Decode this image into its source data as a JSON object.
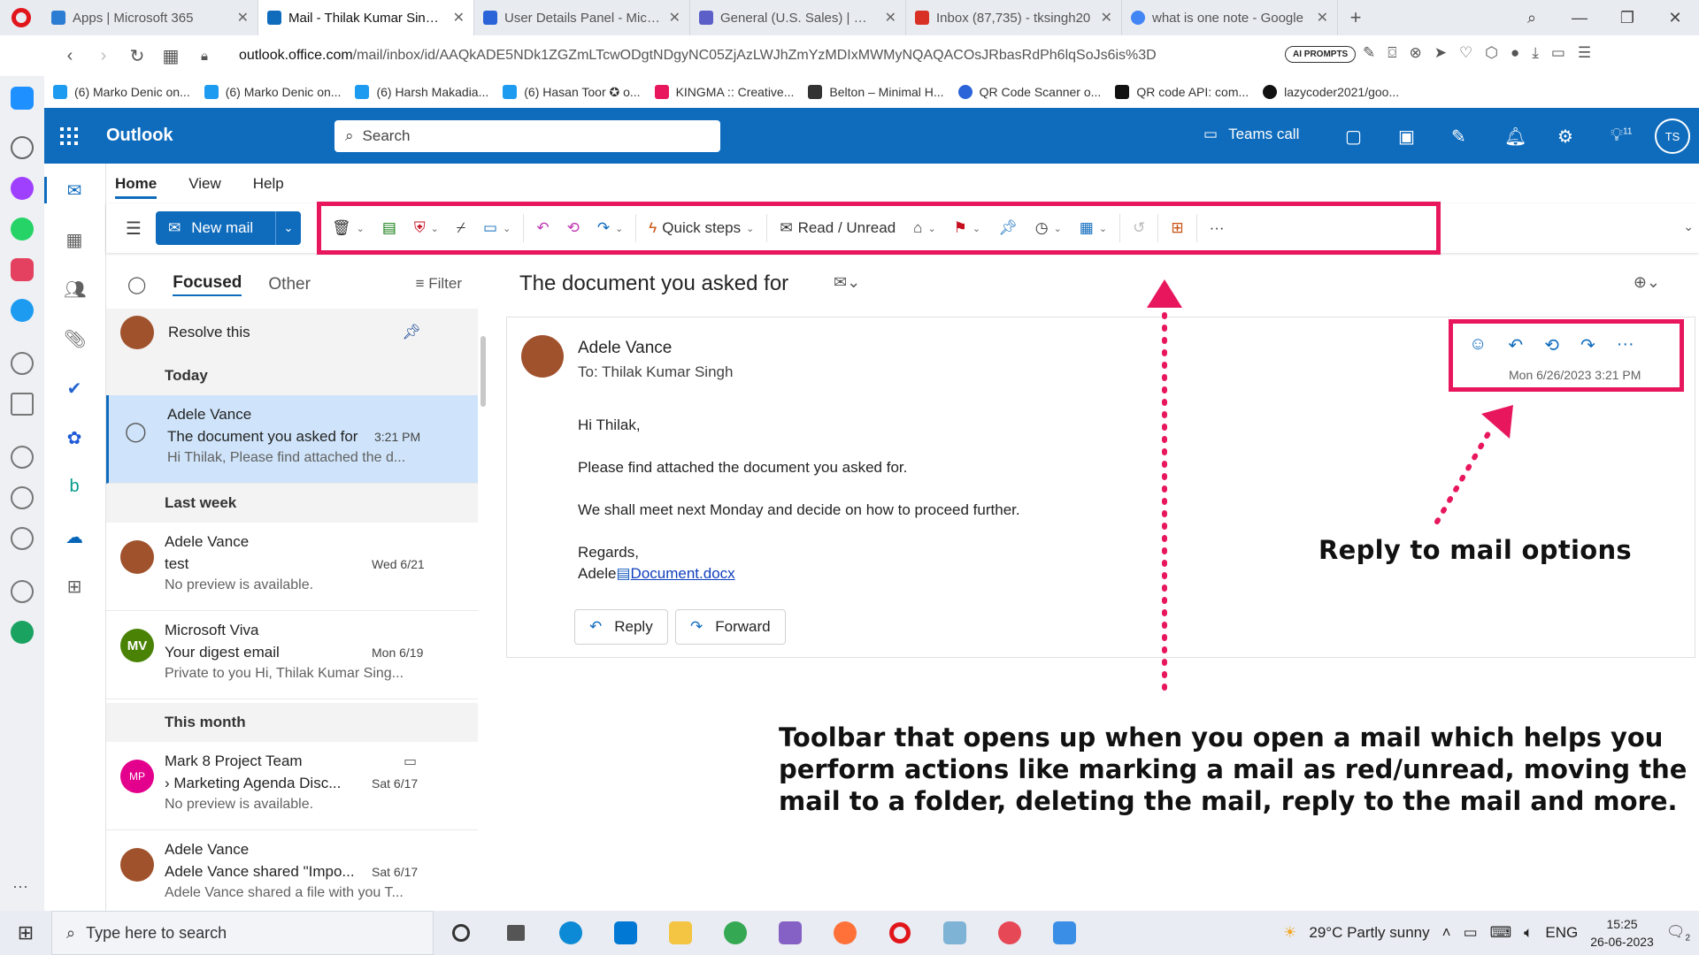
{
  "browser": {
    "tabs": [
      {
        "title": "Apps | Microsoft 365",
        "color": "#2b7cd3"
      },
      {
        "title": "Mail - Thilak Kumar Singh -",
        "color": "#0f6cbd"
      },
      {
        "title": "User Details Panel - Micros",
        "color": "#2b63d8"
      },
      {
        "title": "General (U.S. Sales) | Micro",
        "color": "#5b5fc7"
      },
      {
        "title": "Inbox (87,735) - tksingh20",
        "color": "#d93025"
      },
      {
        "title": "what is one note - Google",
        "color": "#4285f4"
      }
    ],
    "url_host": "outlook.office.com",
    "url_path": "/mail/inbox/id/AAQkADE5NDk1ZGZmLTcwODgtNDgyNC05ZjAzLWJhZmYzMDIxMWMyNQAQACOsJRbasRdPh6lqSoJs6is%3D",
    "ai_prompts": "AI PROMPTS",
    "bookmarks": [
      {
        "label": "(6) Marko Denic on...",
        "color": "#1d9bf0"
      },
      {
        "label": "(6) Marko Denic on...",
        "color": "#1d9bf0"
      },
      {
        "label": "(6) Harsh Makadia...",
        "color": "#1d9bf0"
      },
      {
        "label": "(6) Hasan Toor ✪ o...",
        "color": "#1d9bf0"
      },
      {
        "label": "KINGMA :: Creative...",
        "color": "#e8175d"
      },
      {
        "label": "Belton – Minimal H...",
        "color": "#333333"
      },
      {
        "label": "QR Code Scanner o...",
        "color": "#2b63d8"
      },
      {
        "label": "QR code API: com...",
        "color": "#111111"
      },
      {
        "label": "lazycoder2021/goo...",
        "color": "#111111"
      }
    ]
  },
  "outlook": {
    "app_name": "Outlook",
    "search_placeholder": "Search",
    "teams_call": "Teams call",
    "badge_count": "11",
    "user_initials": "TS",
    "ribbon_tabs": [
      "Home",
      "View",
      "Help"
    ],
    "new_mail": "New mail",
    "quick_steps": "Quick steps",
    "read_unread": "Read / Unread"
  },
  "list": {
    "tab_focused": "Focused",
    "tab_other": "Other",
    "filter": "Filter",
    "pinned": "Resolve this",
    "groups": {
      "today": "Today",
      "last_week": "Last week",
      "this_month": "This month"
    },
    "items": [
      {
        "from": "Adele Vance",
        "subject": "The document you asked for",
        "time": "3:21 PM",
        "preview": "Hi Thilak, Please find attached the d..."
      },
      {
        "from": "Adele Vance",
        "subject": "test",
        "time": "Wed 6/21",
        "preview": "No preview is available."
      },
      {
        "from": "Microsoft Viva",
        "subject": "Your digest email",
        "time": "Mon 6/19",
        "preview": "Private to you Hi, Thilak Kumar Sing...",
        "initials": "MV"
      },
      {
        "from": "Mark 8 Project Team",
        "subject": "Marketing Agenda Disc...",
        "time": "Sat 6/17",
        "preview": "No preview is available.",
        "initials": "MP"
      },
      {
        "from": "Adele Vance",
        "subject": "Adele Vance shared \"Impo...",
        "time": "Sat 6/17",
        "preview": "Adele Vance shared a file with you T..."
      }
    ]
  },
  "reading": {
    "subject": "The document you asked for",
    "from": "Adele Vance",
    "to_label": "To:",
    "to": "Thilak Kumar Singh",
    "date": "Mon 6/26/2023 3:21 PM",
    "greeting": "Hi Thilak,",
    "line1": "Please find attached the document you asked for.",
    "line2": "We shall meet next Monday and decide on how to proceed further.",
    "regards": "Regards,",
    "sign": "Adele",
    "attachment": "Document.docx",
    "reply": "Reply",
    "forward": "Forward"
  },
  "annotations": {
    "reply_options": "Reply to mail options",
    "toolbar": "Toolbar that opens up when you open a mail  which helps you perform actions like marking a mail as red/unread, moving the mail to a folder, deleting the mail, reply to the mail and more."
  },
  "taskbar": {
    "search": "Type here to search",
    "weather": "29°C  Partly sunny",
    "lang": "ENG",
    "time": "15:25",
    "date": "26-06-2023",
    "notif": "2"
  },
  "colors": {
    "accent": "#0f6cbd",
    "highlight": "#e8175d",
    "selected": "#cfe4fa"
  }
}
